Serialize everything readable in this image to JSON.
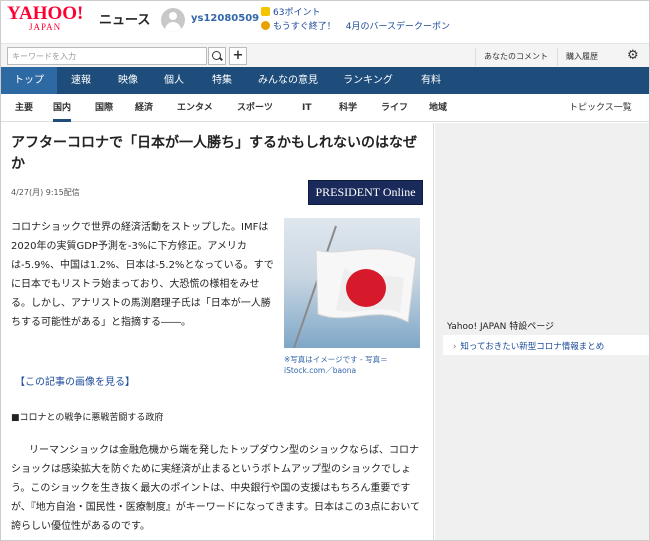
{
  "header": {
    "logo": "YAHOO!",
    "logo_sub": "JAPAN",
    "section_label": "ニュース",
    "username": "ys12080509",
    "points": "63ポイント",
    "promo": "もうすぐ終了！",
    "promo_link": "4月のバースデークーポン"
  },
  "search": {
    "placeholder": "キーワードを入力",
    "comments_link": "あなたのコメント",
    "history_link": "購入履歴"
  },
  "main_nav": [
    "トップ",
    "速報",
    "映像",
    "個人",
    "特集",
    "みんなの意見",
    "ランキング",
    "有料"
  ],
  "sub_nav": [
    "主要",
    "国内",
    "国際",
    "経済",
    "エンタメ",
    "スポーツ",
    "IT",
    "科学",
    "ライフ",
    "地域"
  ],
  "sub_nav_active": "国内",
  "topics_link": "トピックス一覧",
  "article": {
    "title": "アフターコロナで「日本が一人勝ち」するかもしれないのはなぜか",
    "date": "4/27(月) 9:15配信",
    "publisher": "PRESIDENT Online",
    "lead": "コロナショックで世界の経済活動をストップした。IMFは2020年の実質GDP予測を-3%に下方修正。アメリカは-5.9%、中国は1.2%、日本は-5.2%となっている。すでに日本でもリストラ始まっており、大恐慌の様相をみせる。しかし、アナリストの馬渕磨理子氏は「日本が一人勝ちする可能性がある」と指摘する――。",
    "photo_caption": "※写真はイメージです - 写真＝iStock.com／baona",
    "view_images": "【この記事の画像を見る】",
    "subheading": "■コロナとの戦争に悪戦苦闘する政府",
    "body": "リーマンショックは金融危機から端を発したトップダウン型のショックならば、コロナショックは感染拡大を防ぐために実経済が止まるというボトムアップ型のショックでしょう。このショックを生き抜く最大のポイントは、中央銀行や国の支援はもちろん重要ですが、『地方自治・国民性・医療制度』がキーワードになってきます。日本はこの3点において誇らしい優位性があるのです。"
  },
  "sidebar": {
    "title": "Yahoo! JAPAN 特設ページ",
    "link": "知っておきたい新型コロナ情報まとめ"
  },
  "colors": {
    "nav_bg": "#1e4d7b",
    "logo_red": "#ff0033",
    "link_blue": "#1a4a99"
  }
}
